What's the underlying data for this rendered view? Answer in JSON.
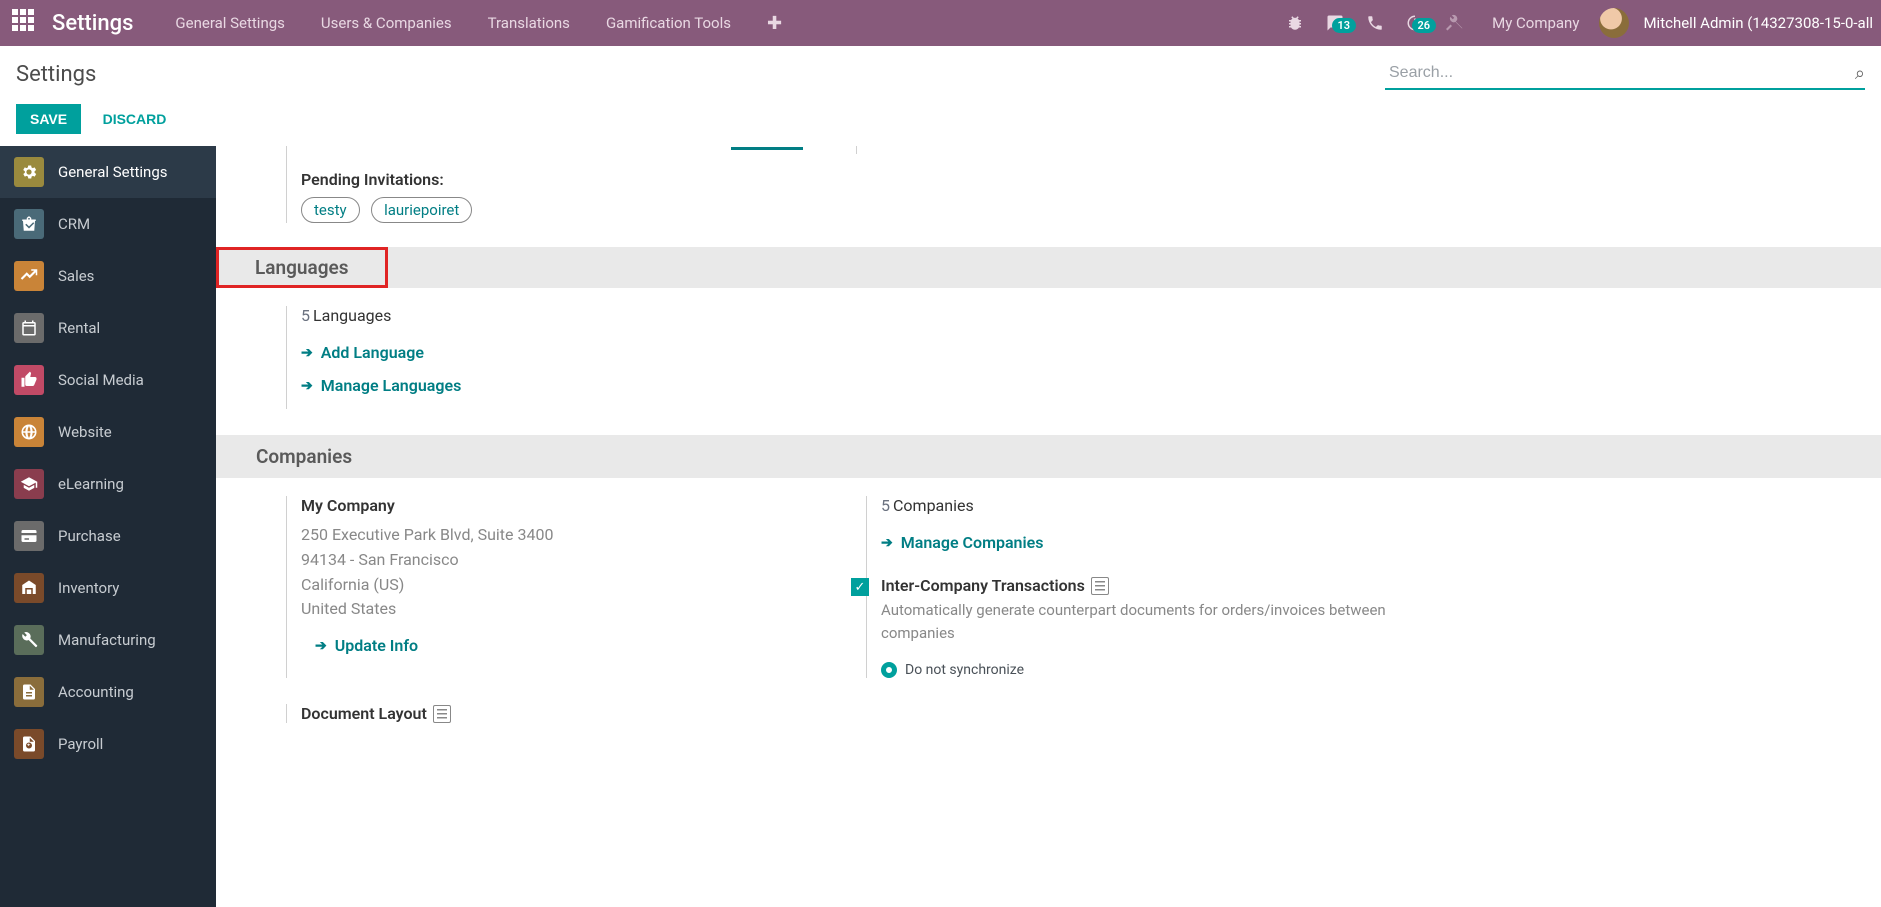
{
  "topnav": {
    "brand": "Settings",
    "menu": [
      "General Settings",
      "Users & Companies",
      "Translations",
      "Gamification Tools"
    ],
    "badges": {
      "messages": "13",
      "activities": "26"
    },
    "company": "My Company",
    "user": "Mitchell Admin (14327308-15-0-all"
  },
  "control": {
    "breadcrumb": "Settings",
    "search_placeholder": "Search...",
    "save": "SAVE",
    "discard": "DISCARD"
  },
  "sidebar": [
    {
      "label": "General Settings",
      "color": "#9a8a3e",
      "selected": true
    },
    {
      "label": "CRM",
      "color": "#4a6a78"
    },
    {
      "label": "Sales",
      "color": "#c98438"
    },
    {
      "label": "Rental",
      "color": "#6b6b6b"
    },
    {
      "label": "Social Media",
      "color": "#c14a66"
    },
    {
      "label": "Website",
      "color": "#c98438"
    },
    {
      "label": "eLearning",
      "color": "#8a3d4e"
    },
    {
      "label": "Purchase",
      "color": "#6b6b6b"
    },
    {
      "label": "Inventory",
      "color": "#7a4a2a"
    },
    {
      "label": "Manufacturing",
      "color": "#5a6d5a"
    },
    {
      "label": "Accounting",
      "color": "#8a6d3b"
    },
    {
      "label": "Payroll",
      "color": "#7a4a2a"
    }
  ],
  "pending": {
    "label": "Pending Invitations:",
    "tags": [
      "testy",
      "lauriepoiret"
    ]
  },
  "languages": {
    "header": "Languages",
    "count": "5",
    "count_label": "Languages",
    "add": "Add Language",
    "manage": "Manage Languages"
  },
  "companies": {
    "header": "Companies",
    "my": {
      "name": "My Company",
      "line1": "250 Executive Park Blvd, Suite 3400",
      "line2": "94134 - San Francisco",
      "line3": "California (US)",
      "line4": "United States",
      "update": "Update Info"
    },
    "count": "5",
    "count_label": "Companies",
    "manage": "Manage Companies",
    "inter": {
      "title": "Inter-Company Transactions",
      "desc": "Automatically generate counterpart documents for orders/invoices between companies",
      "radio1": "Do not synchronize"
    },
    "doclayout": "Document Layout"
  }
}
